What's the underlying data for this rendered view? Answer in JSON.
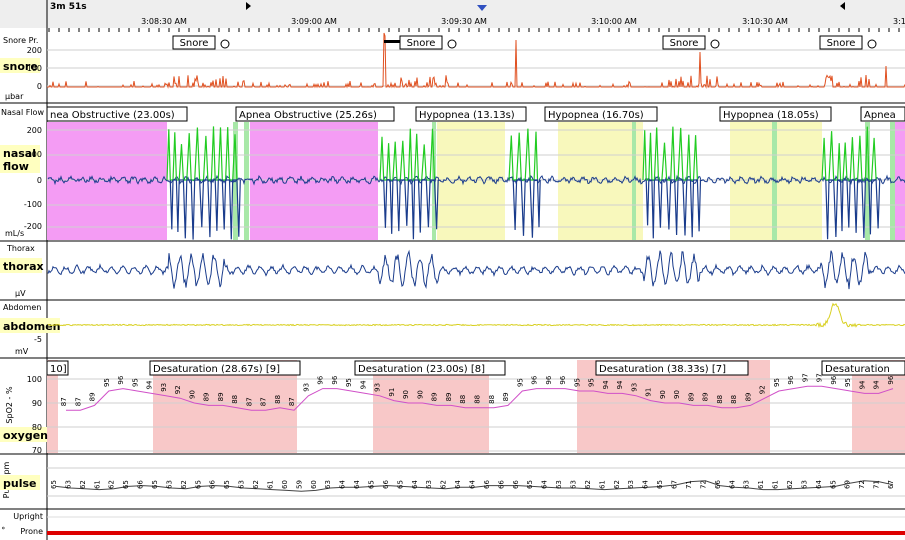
{
  "header": {
    "epoch_label": "3m 51s",
    "times": [
      "3:08:30 AM",
      "3:09:00 AM",
      "3:09:30 AM",
      "3:10:00 AM",
      "3:10:30 AM",
      "3:1"
    ]
  },
  "colors": {
    "apnea": "#f49cf4",
    "hypopnea": "#f8f8bc",
    "desat": "#f8c8c8",
    "flow_green": "#22cc22",
    "flow_blue": "#1a3c8c",
    "snore": "#e05020",
    "abdomen": "#d8d020",
    "oxygen": "#d050c8",
    "position_bar": "#dd0000",
    "name_bg": "#ffffc0"
  },
  "channels": {
    "snore": {
      "short": "Snore Pr.",
      "name": "snore",
      "unit": "µbar",
      "ticks": [
        "200",
        "100",
        "0"
      ]
    },
    "flow": {
      "short": "Nasal Flow",
      "name": "nasal flow",
      "unit": "mL/s",
      "ticks": [
        "200",
        "100",
        "0",
        "-100",
        "-200"
      ]
    },
    "thorax": {
      "short": "Thorax",
      "name": "thorax",
      "unit": "µV"
    },
    "abdomen": {
      "short": "Abdomen",
      "name": "abdomen",
      "unit": "mV",
      "ticks": [
        "-5"
      ]
    },
    "oxygen": {
      "short": "SpO2 - %",
      "name": "oxygen",
      "ticks": [
        "100",
        "90",
        "80",
        "70"
      ]
    },
    "pulse": {
      "short": "Puls bpm",
      "name": "pulse"
    },
    "position": {
      "short": "°",
      "upright": "Upright",
      "prone": "Prone"
    }
  },
  "events": {
    "snore": [
      "Snore",
      "Snore",
      "Snore",
      "Snore"
    ],
    "flow": [
      "nea Obstructive (23.00s)",
      "Apnea Obstructive (25.26s)",
      "Hypopnea (13.13s)",
      "Hypopnea (16.70s)",
      "Hypopnea (18.05s)",
      "Apnea"
    ],
    "desat": [
      "10]",
      "Desaturation (28.67s) [9]",
      "Desaturation (23.00s) [8]",
      "Desaturation (38.33s) [7]",
      "Desaturation"
    ]
  },
  "chart_data": {
    "type": "line",
    "time_range": [
      "3:08:07 AM",
      "3:10:58 AM"
    ],
    "spo2_values": [
      "87",
      "87",
      "89",
      "95",
      "96",
      "95",
      "94",
      "93",
      "92",
      "90",
      "89",
      "89",
      "88",
      "87",
      "87",
      "88",
      "87",
      "93",
      "96",
      "96",
      "95",
      "94",
      "93",
      "91",
      "90",
      "90",
      "89",
      "89",
      "88",
      "88",
      "88",
      "89",
      "95",
      "96",
      "96",
      "96",
      "95",
      "95",
      "94",
      "94",
      "93",
      "91",
      "90",
      "90",
      "89",
      "89",
      "88",
      "88",
      "89",
      "92",
      "95",
      "96",
      "97",
      "97",
      "96",
      "95",
      "94",
      "94",
      "96"
    ],
    "pulse_values": [
      "65",
      "63",
      "62",
      "61",
      "62",
      "65",
      "66",
      "65",
      "63",
      "62",
      "65",
      "66",
      "65",
      "63",
      "62",
      "61",
      "60",
      "59",
      "60",
      "63",
      "64",
      "64",
      "65",
      "66",
      "65",
      "64",
      "63",
      "62",
      "64",
      "64",
      "66",
      "66",
      "66",
      "65",
      "64",
      "63",
      "63",
      "62",
      "61",
      "62",
      "63",
      "64",
      "65",
      "67",
      "71",
      "72",
      "66",
      "64",
      "63",
      "61",
      "61",
      "62",
      "63",
      "64",
      "65",
      "69",
      "72",
      "71",
      "67"
    ]
  }
}
